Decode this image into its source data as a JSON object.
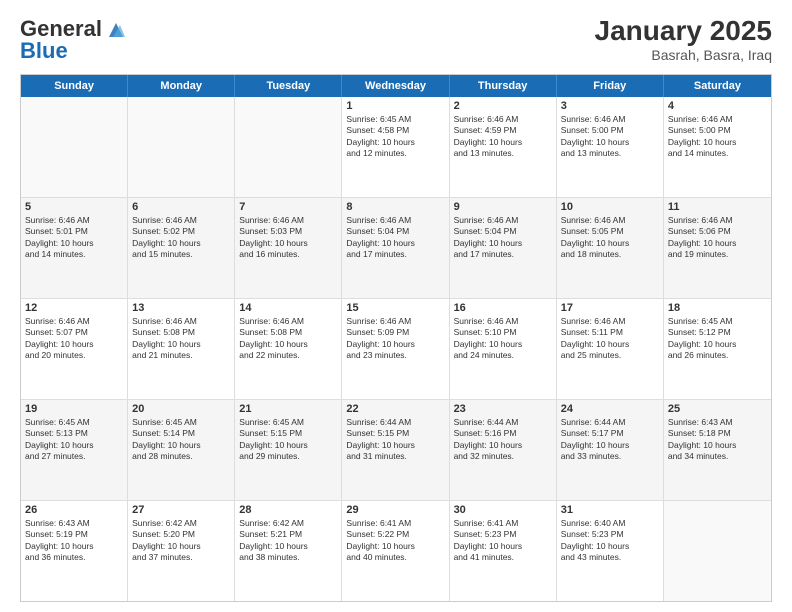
{
  "header": {
    "logo_general": "General",
    "logo_blue": "Blue",
    "title": "January 2025",
    "subtitle": "Basrah, Basra, Iraq"
  },
  "weekdays": [
    "Sunday",
    "Monday",
    "Tuesday",
    "Wednesday",
    "Thursday",
    "Friday",
    "Saturday"
  ],
  "rows": [
    [
      {
        "day": "",
        "lines": [],
        "empty": true
      },
      {
        "day": "",
        "lines": [],
        "empty": true
      },
      {
        "day": "",
        "lines": [],
        "empty": true
      },
      {
        "day": "1",
        "lines": [
          "Sunrise: 6:45 AM",
          "Sunset: 4:58 PM",
          "Daylight: 10 hours",
          "and 12 minutes."
        ]
      },
      {
        "day": "2",
        "lines": [
          "Sunrise: 6:46 AM",
          "Sunset: 4:59 PM",
          "Daylight: 10 hours",
          "and 13 minutes."
        ]
      },
      {
        "day": "3",
        "lines": [
          "Sunrise: 6:46 AM",
          "Sunset: 5:00 PM",
          "Daylight: 10 hours",
          "and 13 minutes."
        ]
      },
      {
        "day": "4",
        "lines": [
          "Sunrise: 6:46 AM",
          "Sunset: 5:00 PM",
          "Daylight: 10 hours",
          "and 14 minutes."
        ]
      }
    ],
    [
      {
        "day": "5",
        "lines": [
          "Sunrise: 6:46 AM",
          "Sunset: 5:01 PM",
          "Daylight: 10 hours",
          "and 14 minutes."
        ],
        "shade": true
      },
      {
        "day": "6",
        "lines": [
          "Sunrise: 6:46 AM",
          "Sunset: 5:02 PM",
          "Daylight: 10 hours",
          "and 15 minutes."
        ],
        "shade": true
      },
      {
        "day": "7",
        "lines": [
          "Sunrise: 6:46 AM",
          "Sunset: 5:03 PM",
          "Daylight: 10 hours",
          "and 16 minutes."
        ],
        "shade": true
      },
      {
        "day": "8",
        "lines": [
          "Sunrise: 6:46 AM",
          "Sunset: 5:04 PM",
          "Daylight: 10 hours",
          "and 17 minutes."
        ],
        "shade": true
      },
      {
        "day": "9",
        "lines": [
          "Sunrise: 6:46 AM",
          "Sunset: 5:04 PM",
          "Daylight: 10 hours",
          "and 17 minutes."
        ],
        "shade": true
      },
      {
        "day": "10",
        "lines": [
          "Sunrise: 6:46 AM",
          "Sunset: 5:05 PM",
          "Daylight: 10 hours",
          "and 18 minutes."
        ],
        "shade": true
      },
      {
        "day": "11",
        "lines": [
          "Sunrise: 6:46 AM",
          "Sunset: 5:06 PM",
          "Daylight: 10 hours",
          "and 19 minutes."
        ],
        "shade": true
      }
    ],
    [
      {
        "day": "12",
        "lines": [
          "Sunrise: 6:46 AM",
          "Sunset: 5:07 PM",
          "Daylight: 10 hours",
          "and 20 minutes."
        ]
      },
      {
        "day": "13",
        "lines": [
          "Sunrise: 6:46 AM",
          "Sunset: 5:08 PM",
          "Daylight: 10 hours",
          "and 21 minutes."
        ]
      },
      {
        "day": "14",
        "lines": [
          "Sunrise: 6:46 AM",
          "Sunset: 5:08 PM",
          "Daylight: 10 hours",
          "and 22 minutes."
        ]
      },
      {
        "day": "15",
        "lines": [
          "Sunrise: 6:46 AM",
          "Sunset: 5:09 PM",
          "Daylight: 10 hours",
          "and 23 minutes."
        ]
      },
      {
        "day": "16",
        "lines": [
          "Sunrise: 6:46 AM",
          "Sunset: 5:10 PM",
          "Daylight: 10 hours",
          "and 24 minutes."
        ]
      },
      {
        "day": "17",
        "lines": [
          "Sunrise: 6:46 AM",
          "Sunset: 5:11 PM",
          "Daylight: 10 hours",
          "and 25 minutes."
        ]
      },
      {
        "day": "18",
        "lines": [
          "Sunrise: 6:45 AM",
          "Sunset: 5:12 PM",
          "Daylight: 10 hours",
          "and 26 minutes."
        ]
      }
    ],
    [
      {
        "day": "19",
        "lines": [
          "Sunrise: 6:45 AM",
          "Sunset: 5:13 PM",
          "Daylight: 10 hours",
          "and 27 minutes."
        ],
        "shade": true
      },
      {
        "day": "20",
        "lines": [
          "Sunrise: 6:45 AM",
          "Sunset: 5:14 PM",
          "Daylight: 10 hours",
          "and 28 minutes."
        ],
        "shade": true
      },
      {
        "day": "21",
        "lines": [
          "Sunrise: 6:45 AM",
          "Sunset: 5:15 PM",
          "Daylight: 10 hours",
          "and 29 minutes."
        ],
        "shade": true
      },
      {
        "day": "22",
        "lines": [
          "Sunrise: 6:44 AM",
          "Sunset: 5:15 PM",
          "Daylight: 10 hours",
          "and 31 minutes."
        ],
        "shade": true
      },
      {
        "day": "23",
        "lines": [
          "Sunrise: 6:44 AM",
          "Sunset: 5:16 PM",
          "Daylight: 10 hours",
          "and 32 minutes."
        ],
        "shade": true
      },
      {
        "day": "24",
        "lines": [
          "Sunrise: 6:44 AM",
          "Sunset: 5:17 PM",
          "Daylight: 10 hours",
          "and 33 minutes."
        ],
        "shade": true
      },
      {
        "day": "25",
        "lines": [
          "Sunrise: 6:43 AM",
          "Sunset: 5:18 PM",
          "Daylight: 10 hours",
          "and 34 minutes."
        ],
        "shade": true
      }
    ],
    [
      {
        "day": "26",
        "lines": [
          "Sunrise: 6:43 AM",
          "Sunset: 5:19 PM",
          "Daylight: 10 hours",
          "and 36 minutes."
        ]
      },
      {
        "day": "27",
        "lines": [
          "Sunrise: 6:42 AM",
          "Sunset: 5:20 PM",
          "Daylight: 10 hours",
          "and 37 minutes."
        ]
      },
      {
        "day": "28",
        "lines": [
          "Sunrise: 6:42 AM",
          "Sunset: 5:21 PM",
          "Daylight: 10 hours",
          "and 38 minutes."
        ]
      },
      {
        "day": "29",
        "lines": [
          "Sunrise: 6:41 AM",
          "Sunset: 5:22 PM",
          "Daylight: 10 hours",
          "and 40 minutes."
        ]
      },
      {
        "day": "30",
        "lines": [
          "Sunrise: 6:41 AM",
          "Sunset: 5:23 PM",
          "Daylight: 10 hours",
          "and 41 minutes."
        ]
      },
      {
        "day": "31",
        "lines": [
          "Sunrise: 6:40 AM",
          "Sunset: 5:23 PM",
          "Daylight: 10 hours",
          "and 43 minutes."
        ]
      },
      {
        "day": "",
        "lines": [],
        "empty": true
      }
    ]
  ]
}
